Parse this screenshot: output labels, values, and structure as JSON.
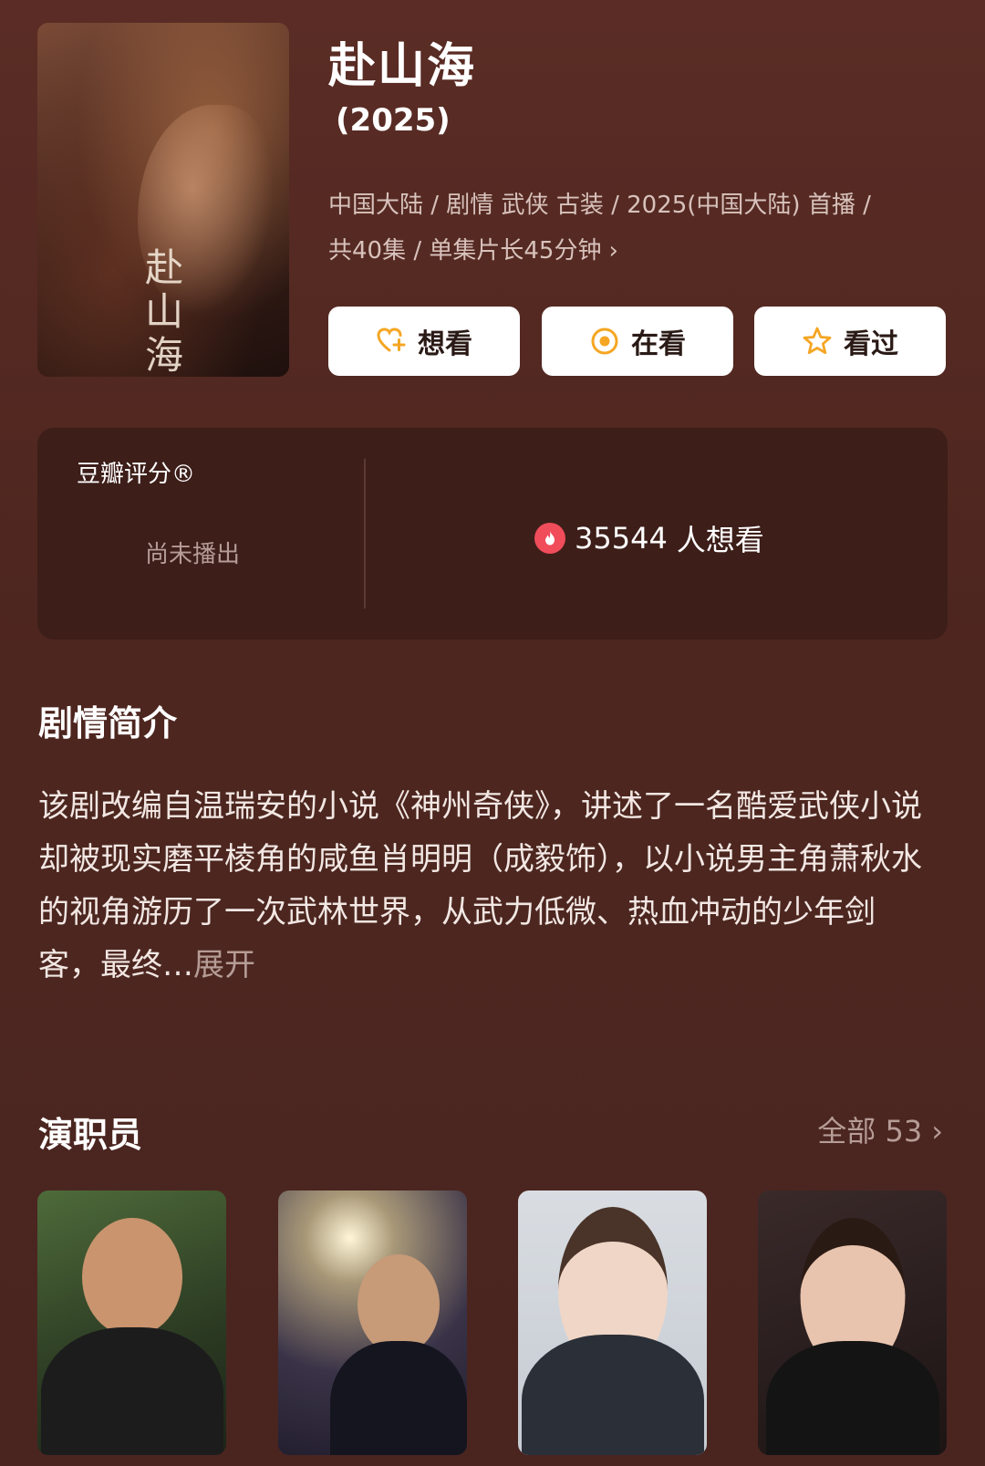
{
  "show": {
    "title": "赴山海",
    "year": "(2025)",
    "meta_line1": "中国大陆 / 剧情 武侠 古装 / 2025(中国大陆) 首播 /",
    "meta_line2": "共40集 / 单集片长45分钟",
    "poster_calligraphy": "赴山海"
  },
  "actions": {
    "want_label": "想看",
    "watching_label": "在看",
    "watched_label": "看过"
  },
  "rating": {
    "label": "豆瓣评分®",
    "status": "尚未播出",
    "want_count": "35544",
    "want_suffix": "人想看"
  },
  "synopsis": {
    "heading": "剧情简介",
    "text": "该剧改编自温瑞安的小说《神州奇侠》，讲述了一名酷爱武侠小说却被现实磨平棱角的咸鱼肖明明（成毅饰），以小说男主角萧秋水的视角游历了一次武林世界，从武力低微、热血冲动的少年剑客，最终…",
    "expand_label": "展开"
  },
  "cast": {
    "heading": "演职员",
    "all_label": "全部 53"
  },
  "colors": {
    "accent_orange": "#f5a623",
    "fire_red": "#f04c5a",
    "background": "#4d261f"
  },
  "icons": {
    "want": "heart-plus-icon",
    "watching": "target-icon",
    "watched": "star-icon",
    "fire": "fire-icon",
    "chevron": "chevron-right-icon"
  }
}
